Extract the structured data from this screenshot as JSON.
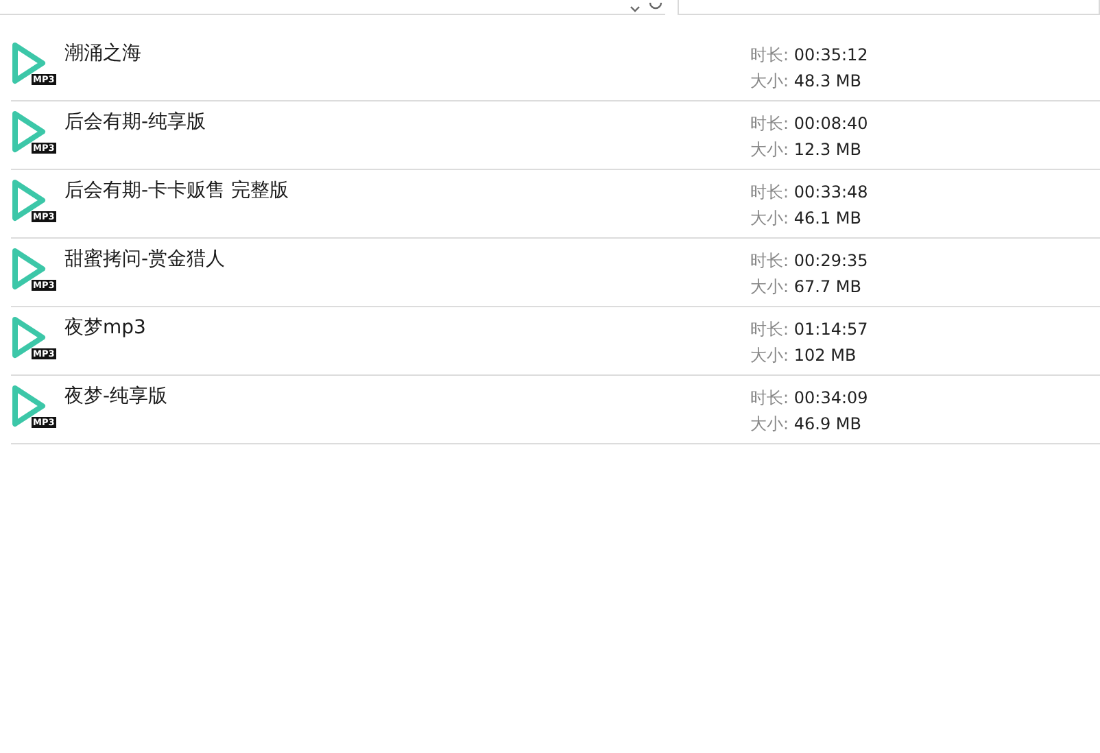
{
  "files": [
    {
      "name": "潮涌之海",
      "badge": "MP3",
      "duration_label": "时长:",
      "duration": "00:35:12",
      "size_label": "大小:",
      "size": "48.3 MB"
    },
    {
      "name": "后会有期-纯享版",
      "badge": "MP3",
      "duration_label": "时长:",
      "duration": "00:08:40",
      "size_label": "大小:",
      "size": "12.3 MB"
    },
    {
      "name": "后会有期-卡卡贩售 完整版",
      "badge": "MP3",
      "duration_label": "时长:",
      "duration": "00:33:48",
      "size_label": "大小:",
      "size": "46.1 MB"
    },
    {
      "name": "甜蜜拷问-赏金猎人",
      "badge": "MP3",
      "duration_label": "时长:",
      "duration": "00:29:35",
      "size_label": "大小:",
      "size": "67.7 MB"
    },
    {
      "name": "夜梦mp3",
      "badge": "MP3",
      "duration_label": "时长:",
      "duration": "01:14:57",
      "size_label": "大小:",
      "size": "102 MB"
    },
    {
      "name": "夜梦-纯享版",
      "badge": "MP3",
      "duration_label": "时长:",
      "duration": "00:34:09",
      "size_label": "大小:",
      "size": "46.9 MB"
    }
  ]
}
